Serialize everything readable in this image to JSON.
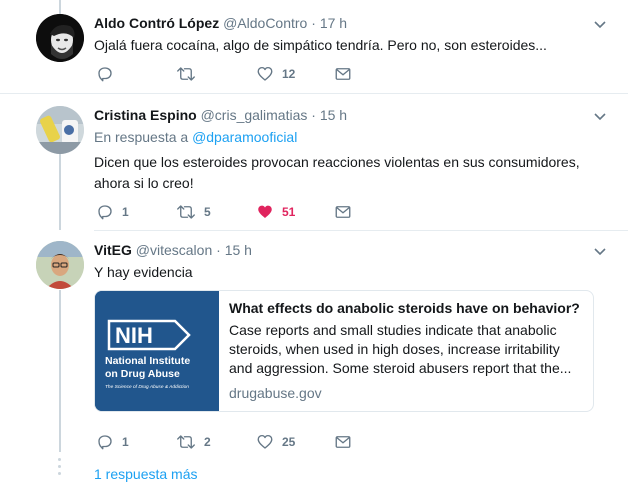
{
  "tweets": [
    {
      "name": "Aldo Contró López",
      "handle": "@AldoContro",
      "dot": "·",
      "time": "17 h",
      "text": "Ojalá fuera cocaína, algo de simpático tendría. Pero no, son esteroides...",
      "replies": "",
      "retweets": "",
      "likes": "12"
    },
    {
      "name": "Cristina Espino",
      "handle": "@cris_galimatias",
      "dot": "·",
      "time": "15 h",
      "reply_prefix": "En respuesta a",
      "reply_to": "@dparamooficial",
      "text": "Dicen que los esteroides provocan reacciones violentas en sus consumidores, ahora si lo creo!",
      "replies": "1",
      "retweets": "5",
      "likes": "51",
      "liked_color": "#e0245e"
    },
    {
      "name": "VitEG",
      "handle": "@vitescalon",
      "dot": "·",
      "time": "15 h",
      "text": "Y hay evidencia",
      "replies": "1",
      "retweets": "2",
      "likes": "25"
    }
  ],
  "card": {
    "logo_text": "NIH",
    "logo_line1": "National Institute",
    "logo_line2": "on Drug Abuse",
    "logo_tagline": "The Science of Drug Abuse & Addiction",
    "title": "What effects do anabolic steroids have on behavior?",
    "description": "Case reports and small studies indicate that anabolic steroids, when used in high doses, increase irritability and aggression. Some steroid abusers report that the...",
    "domain": "drugabuse.gov"
  },
  "more_replies": "1 respuesta más",
  "colors": {
    "accent": "#1da1f2",
    "like": "#e0245e",
    "muted": "#657786",
    "card_brand": "#21568d"
  }
}
